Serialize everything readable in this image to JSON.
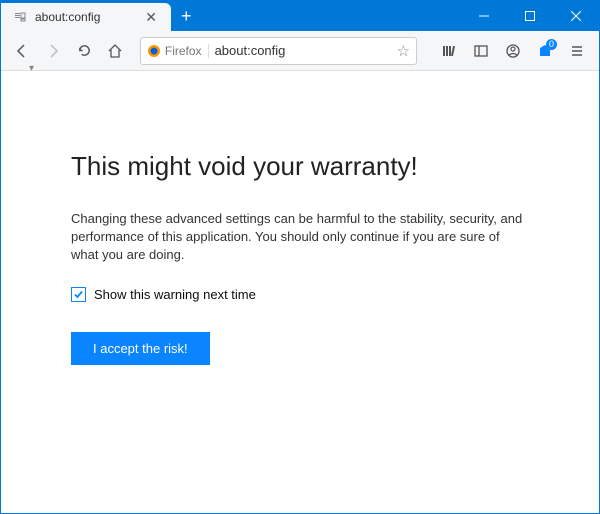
{
  "tab": {
    "title": "about:config"
  },
  "urlbar": {
    "identity": "Firefox",
    "url": "about:config"
  },
  "righticons": {
    "notification_badge": "0"
  },
  "warning": {
    "heading": "This might void your warranty!",
    "body": "Changing these advanced settings can be harmful to the stability, security, and performance of this application. You should only continue if you are sure of what you are doing.",
    "checkbox_label": "Show this warning next time",
    "accept_label": "I accept the risk!"
  }
}
